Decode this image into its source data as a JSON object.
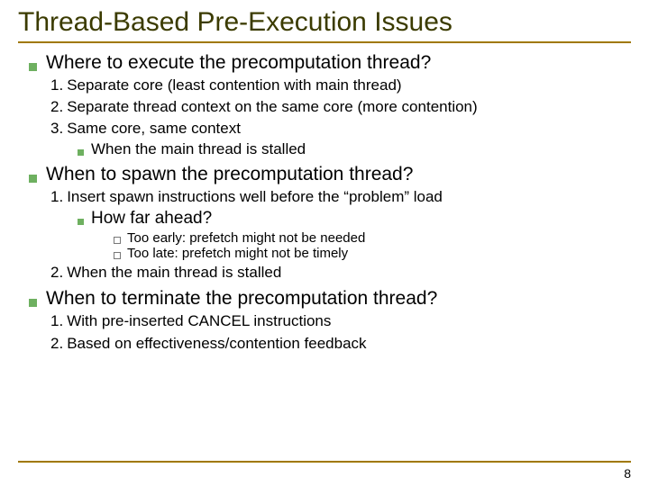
{
  "title": "Thread-Based Pre-Execution Issues",
  "sec1": {
    "heading": "Where to execute the precomputation thread?",
    "items": {
      "n1": "1.",
      "t1": "Separate core (least contention with main thread)",
      "n2": "2.",
      "t2": "Separate thread context on the same core (more contention)",
      "n3": "3.",
      "t3": "Same core, same context",
      "sub": "When the main thread is stalled"
    }
  },
  "sec2": {
    "heading": "When to spawn the precomputation thread?",
    "items": {
      "n1": "1.",
      "t1": "Insert spawn instructions well before the “problem” load",
      "sub1": "How far ahead?",
      "sub2a": "Too early: prefetch might not be needed",
      "sub2b": "Too late: prefetch might not be timely",
      "n2": "2.",
      "t2": "When the main thread is stalled"
    }
  },
  "sec3": {
    "heading": "When to terminate the precomputation thread?",
    "items": {
      "n1": "1.",
      "t1": "With pre-inserted CANCEL instructions",
      "n2": "2.",
      "t2": "Based on effectiveness/contention feedback"
    }
  },
  "page": "8"
}
